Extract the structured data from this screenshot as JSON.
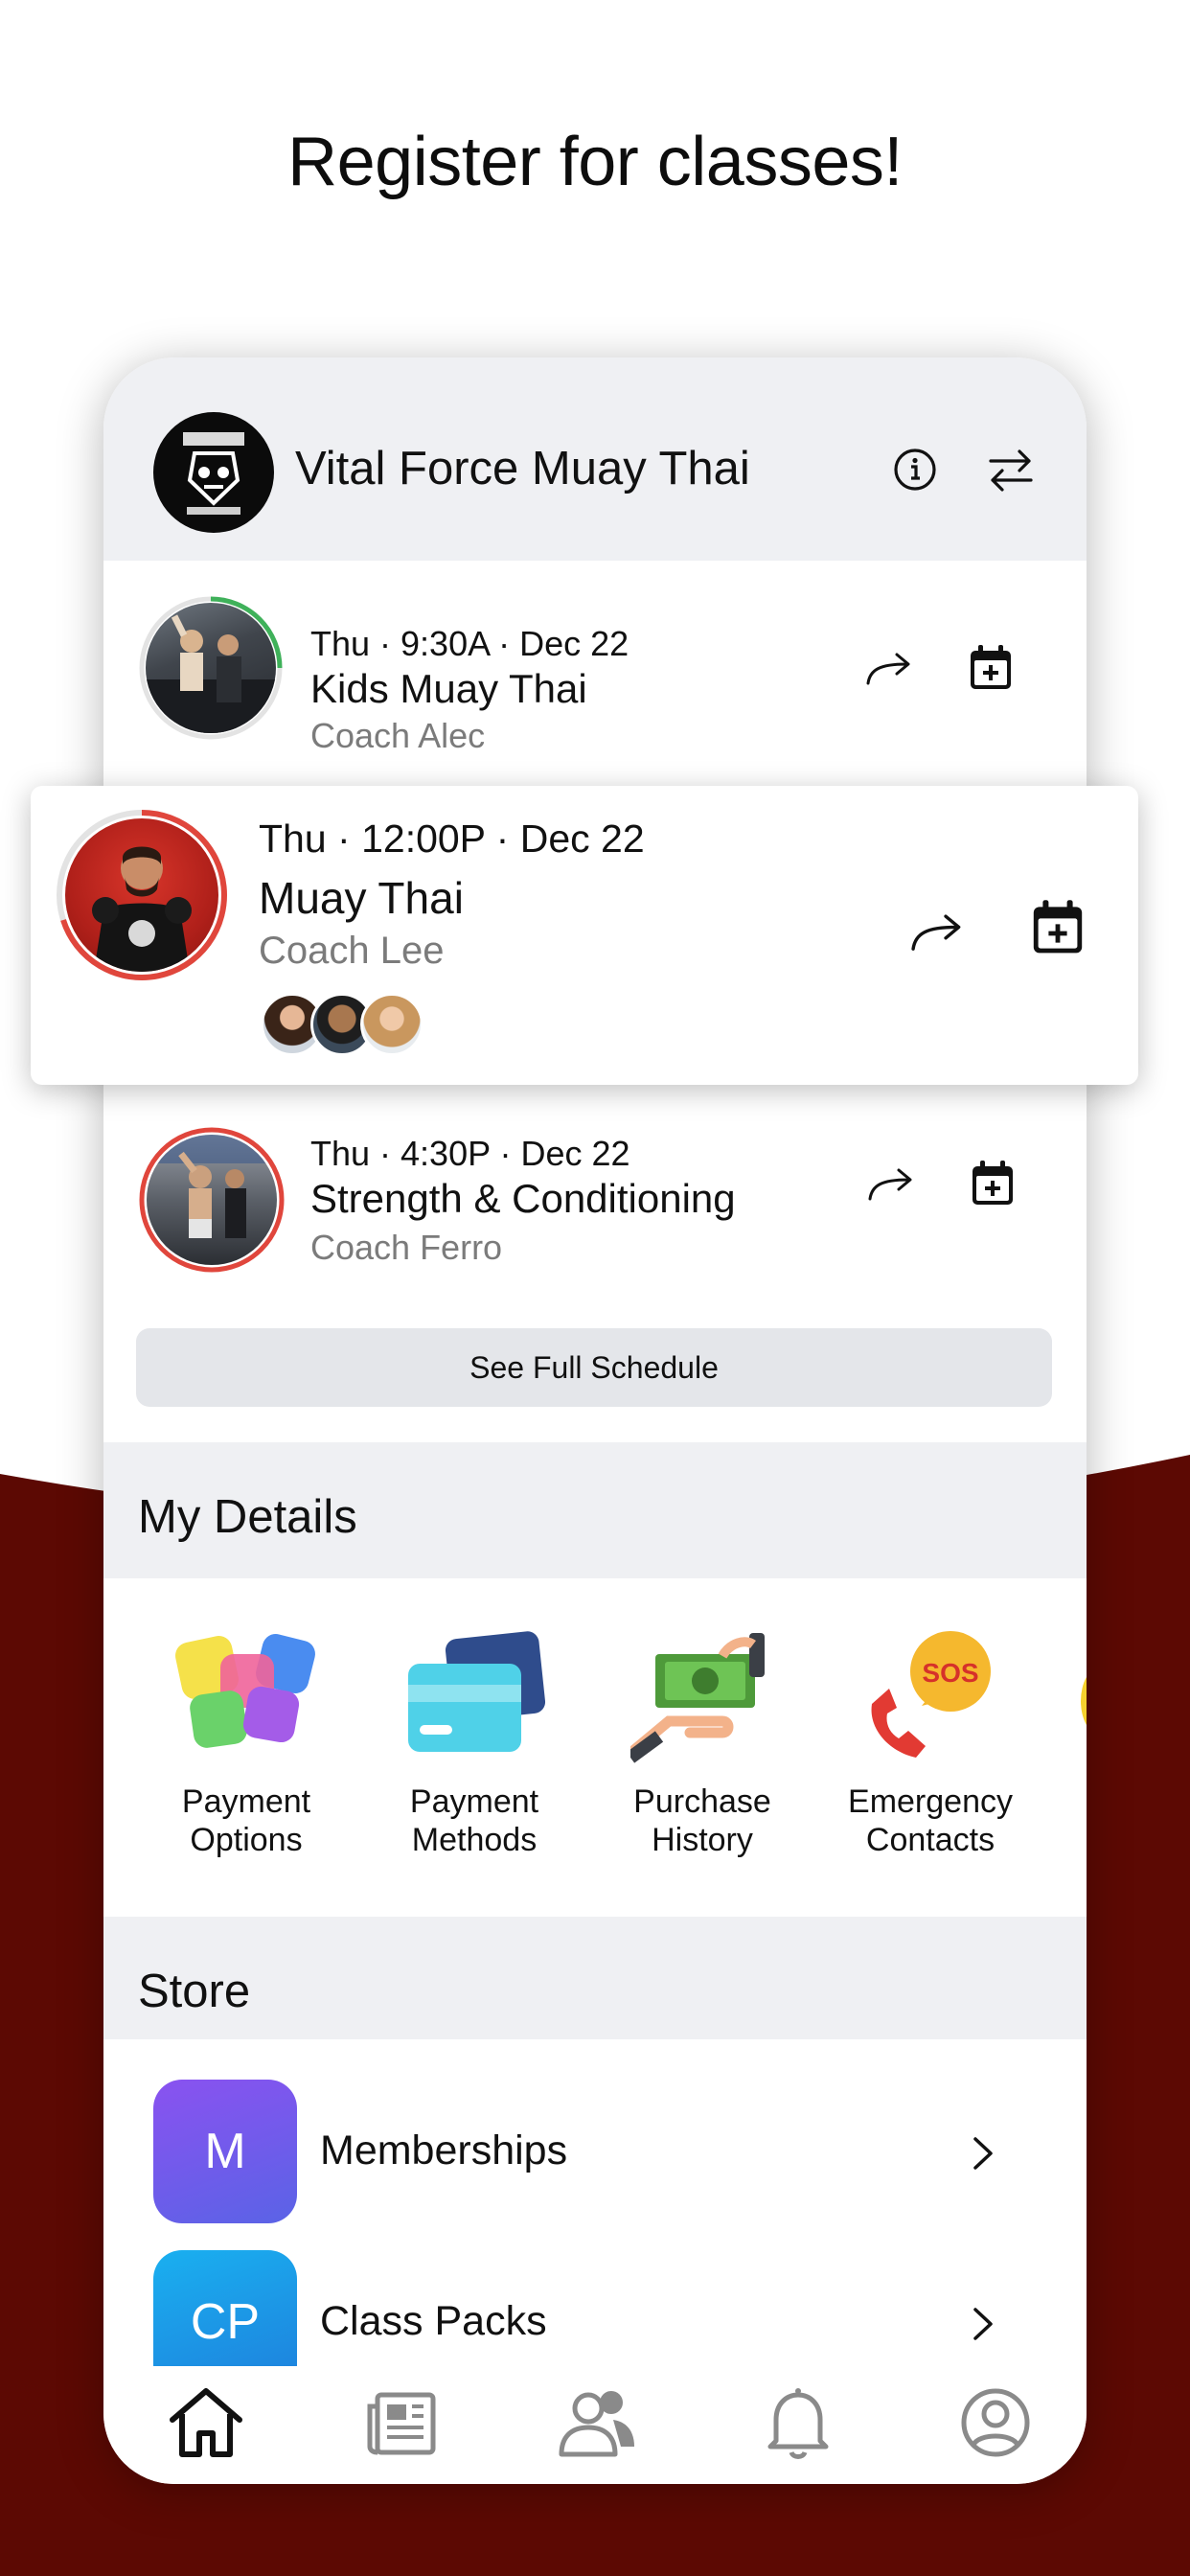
{
  "headline": "Register for classes!",
  "gym": {
    "name": "Vital Force Muay Thai",
    "info_icon": "info-icon",
    "switch_icon": "switch-gym-icon"
  },
  "classes": [
    {
      "when": "Thu · 9:30A · Dec 22",
      "title": "Kids Muay Thai",
      "coach": "Coach Alec",
      "ring_color": "#3fb15a"
    },
    {
      "when": "Thu · 12:00P · Dec 22",
      "title": "Muay Thai",
      "coach": "Coach Lee",
      "ring_color": "#e0463c"
    },
    {
      "when": "Thu · 4:30P · Dec 22",
      "title": "Strength & Conditioning",
      "coach": "Coach Ferro",
      "ring_color": "#e0463c"
    }
  ],
  "see_full_schedule": "See Full Schedule",
  "my_details": {
    "title": "My Details",
    "tiles": [
      {
        "label_line1": "Payment",
        "label_line2": "Options",
        "icon": "payment-options-icon"
      },
      {
        "label_line1": "Payment",
        "label_line2": "Methods",
        "icon": "credit-card-icon"
      },
      {
        "label_line1": "Purchase",
        "label_line2": "History",
        "icon": "cash-hand-icon"
      },
      {
        "label_line1": "Emergency",
        "label_line2": "Contacts",
        "icon": "sos-phone-icon"
      }
    ]
  },
  "store": {
    "title": "Store",
    "items": [
      {
        "badge": "M",
        "label": "Memberships"
      },
      {
        "badge": "CP",
        "label": "Class Packs"
      }
    ]
  },
  "tabs": [
    "home-icon",
    "newspaper-icon",
    "people-icon",
    "bell-icon",
    "profile-icon"
  ],
  "colors": {
    "brand_dark_red": "#5c0903",
    "panel_gray": "#eff0f3",
    "button_gray": "#e4e6ea"
  }
}
